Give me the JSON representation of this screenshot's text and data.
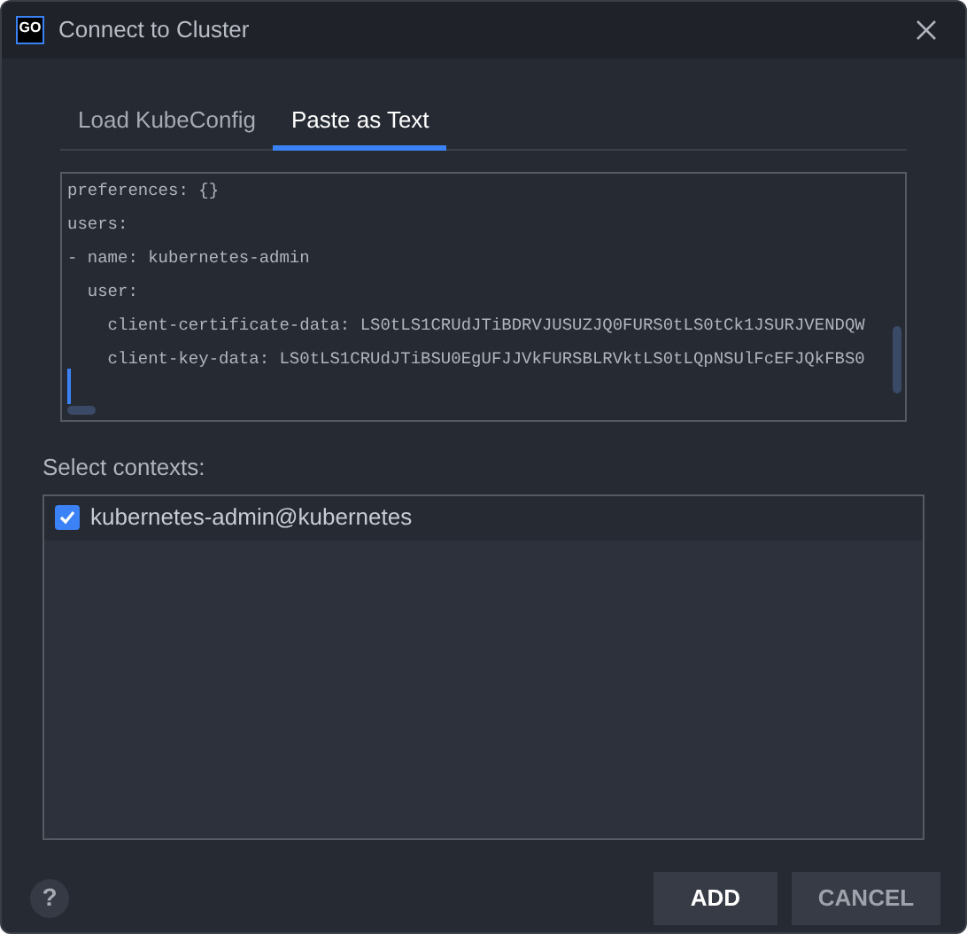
{
  "window": {
    "title": "Connect to Cluster",
    "logo": "GO"
  },
  "tabs": [
    {
      "label": "Load KubeConfig",
      "selected": false
    },
    {
      "label": "Paste as Text",
      "selected": true
    }
  ],
  "editor": {
    "lines": [
      "preferences: {}",
      "users:",
      "- name: kubernetes-admin",
      "  user:",
      "    client-certificate-data: LS0tLS1CRUdJTiBDRVJUSUZJQ0FURS0tLS0tCk1JSURJVENDQW",
      "    client-key-data: LS0tLS1CRUdJTiBSU0EgUFJJVkFURSBLRVktLS0tLQpNSUlFcEFJQkFBS0"
    ]
  },
  "contexts": {
    "label": "Select contexts:",
    "items": [
      {
        "name": "kubernetes-admin@kubernetes",
        "checked": true
      }
    ]
  },
  "help": "?",
  "buttons": [
    {
      "label": "ADD",
      "kind": "primary"
    },
    {
      "label": "CANCEL",
      "kind": "secondary"
    }
  ]
}
